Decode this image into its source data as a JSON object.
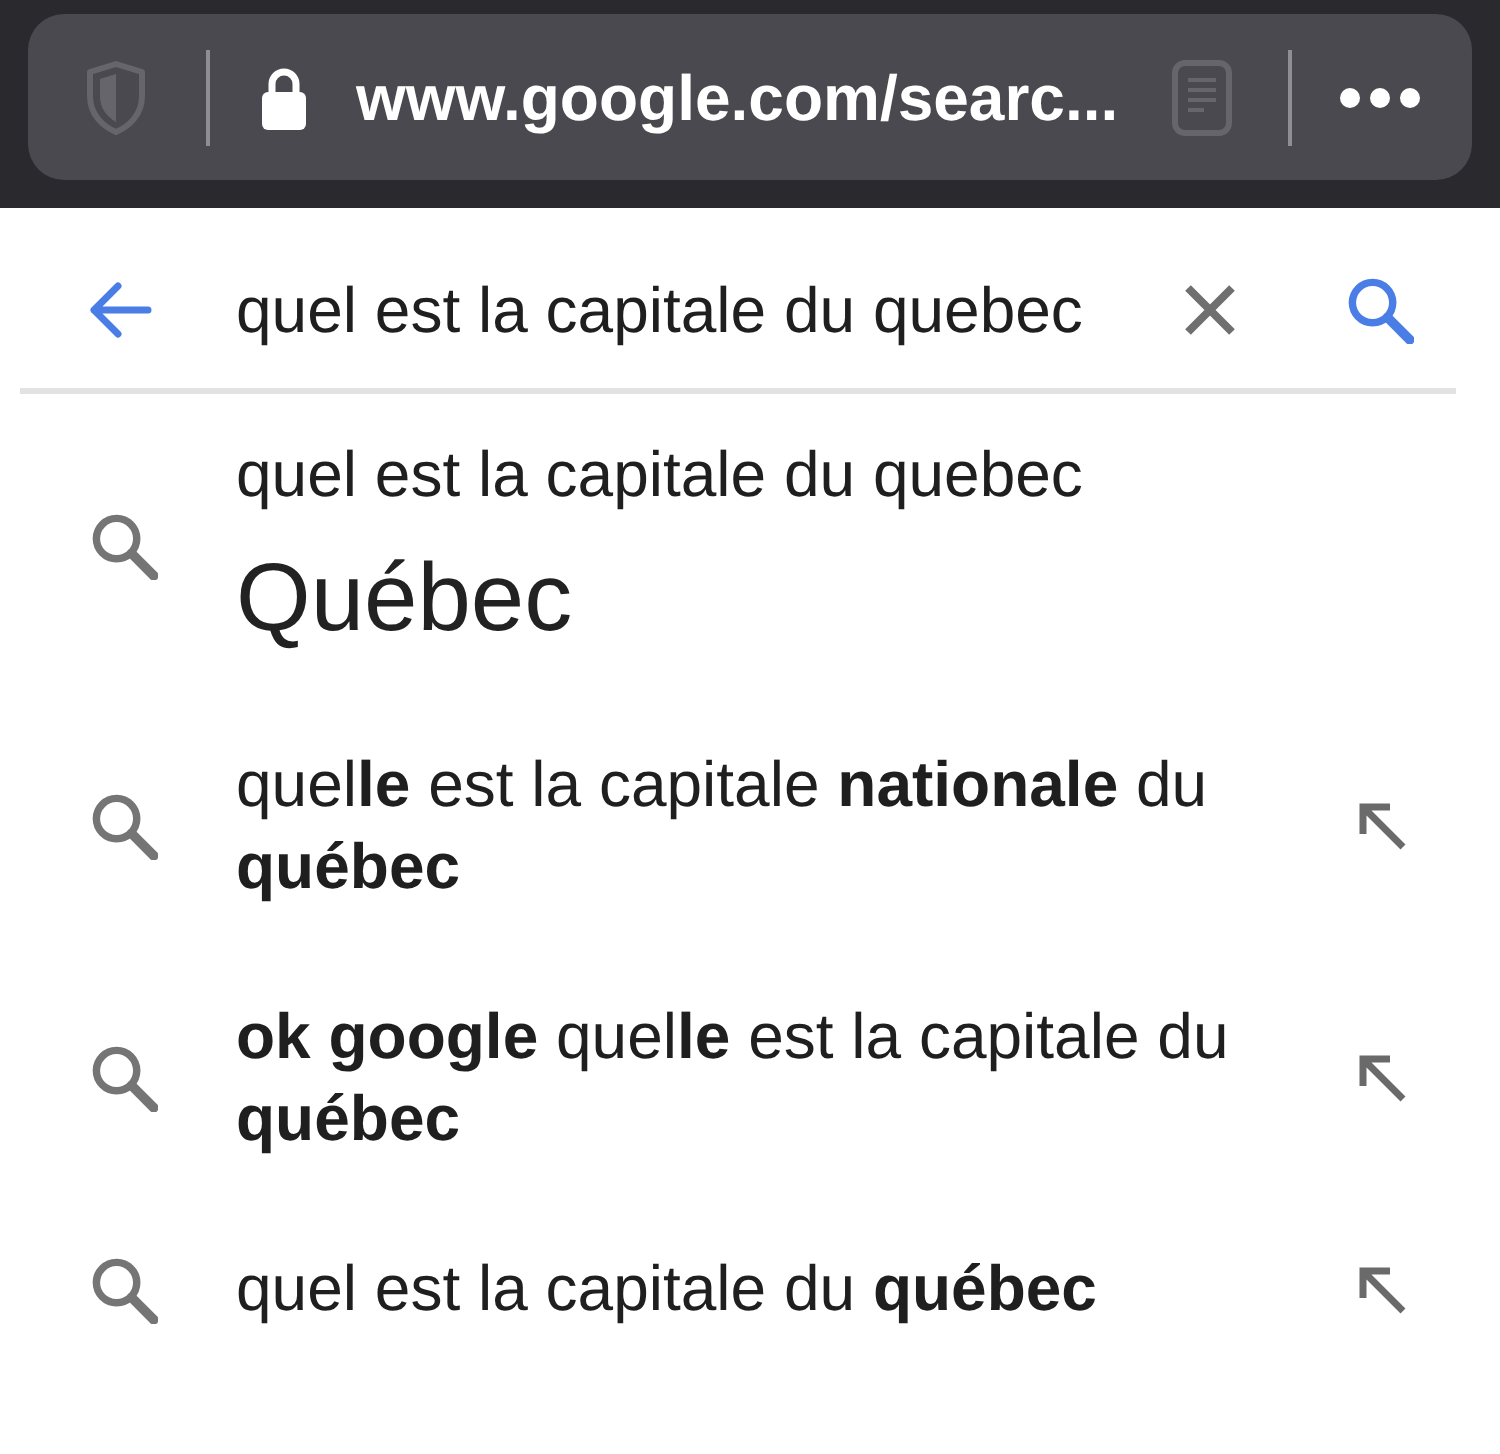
{
  "browser_bar": {
    "url": "www.google.com/searc..."
  },
  "search": {
    "value": "quel est la capitale du quebec"
  },
  "suggestions": [
    {
      "kind": "answer",
      "query": "quel est la capitale du quebec",
      "answer": "Québec"
    },
    {
      "kind": "query",
      "text": "quel**le** est la capitale **nationale** du **québec**"
    },
    {
      "kind": "query",
      "text": "**ok google** quel**le** est la capitale du **québec**"
    },
    {
      "kind": "query",
      "text": "quel est la capitale du **québec**"
    }
  ]
}
